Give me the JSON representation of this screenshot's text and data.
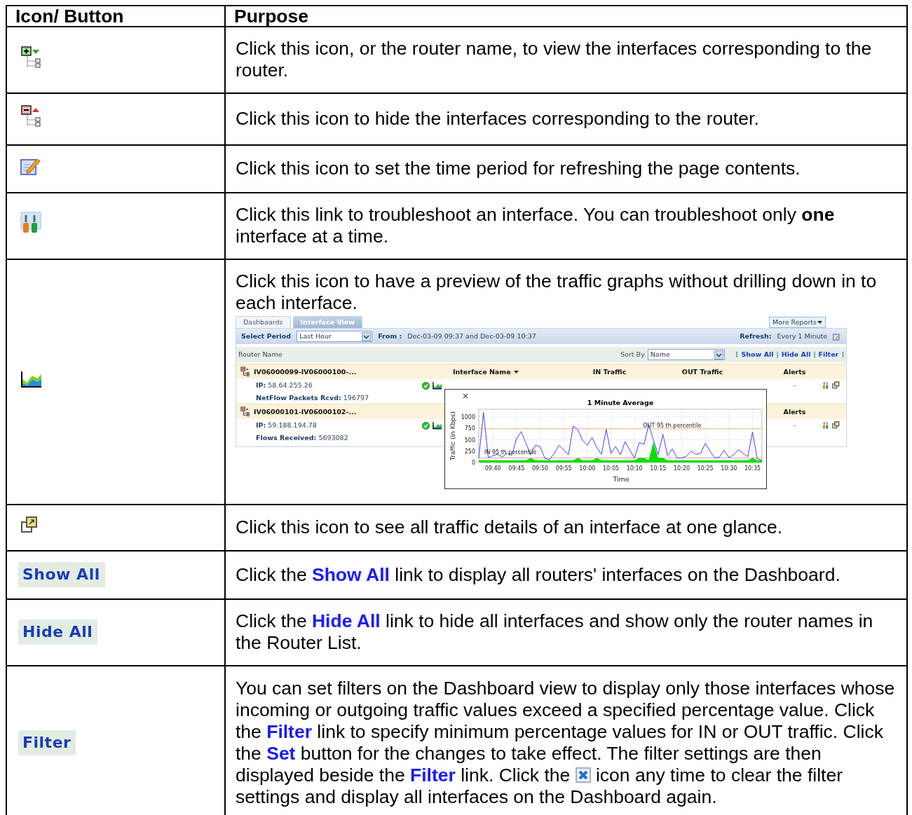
{
  "table": {
    "columns": [
      "Icon/ Button",
      "Purpose"
    ],
    "rows": [
      {
        "left": {
          "kind": "expand"
        },
        "purpose": [
          {
            "kind": "text",
            "text": "Click this icon, or the router name, to view the interfaces corresponding to the router."
          }
        ]
      },
      {
        "left": {
          "kind": "collapse"
        },
        "purpose": [
          {
            "kind": "text",
            "text": "Click this icon to hide the interfaces corresponding to the router."
          }
        ]
      },
      {
        "left": {
          "kind": "edit"
        },
        "purpose": [
          {
            "kind": "text",
            "text": "Click this icon to set the time period for refreshing the page contents."
          }
        ]
      },
      {
        "left": {
          "kind": "troubleshoot"
        },
        "purpose": [
          {
            "kind": "text",
            "text": "Click this link to troubleshoot an interface. You can troubleshoot only "
          },
          {
            "kind": "bold",
            "text": "one"
          },
          {
            "kind": "text",
            "text": " interface at a time."
          }
        ]
      },
      {
        "left": {
          "kind": "graph"
        },
        "purpose": [
          {
            "kind": "text",
            "text": "Click this icon to have a preview of the traffic graphs without drilling down in to each interface."
          }
        ],
        "preview": {
          "tabs": [
            {
              "label": "Dashboards",
              "selected": false
            },
            {
              "label": "Interface View",
              "selected": true
            }
          ],
          "more_reports": "More Reports",
          "period_label": "Select Period",
          "period_value": "Last Hour",
          "from_label": "From :",
          "from_value": "Dec-03-09 09:37 and Dec-03-09 10:37",
          "refresh_label": "Refresh:",
          "refresh_value": "Every 1 Minute",
          "router_name_label": "Router Name",
          "sort_label": "Sort By",
          "sort_value": "Name",
          "links": [
            {
              "kind": "punct",
              "text": "["
            },
            {
              "kind": "link",
              "text": "Show All"
            },
            {
              "kind": "punct",
              "text": "|"
            },
            {
              "kind": "link",
              "text": "Hide All"
            },
            {
              "kind": "punct",
              "text": "|"
            },
            {
              "kind": "link",
              "text": "Filter"
            },
            {
              "kind": "punct",
              "text": "]"
            }
          ],
          "routers": [
            {
              "name": "IV06000099-IV06000100-...",
              "headers": {
                "interface_name": "Interface Name",
                "in_traffic": "IN Traffic",
                "out_traffic": "OUT Traffic",
                "alerts": "Alerts"
              },
              "details": [
                {
                  "label": "IP:",
                  "value": "58.64.255.26"
                },
                {
                  "label": "NetFlow Packets Rcvd:",
                  "value": "196797"
                }
              ],
              "ok": true,
              "alerts": "-"
            },
            {
              "name": "IV06000101-IV06000102-...",
              "headers": {
                "alerts": "Alerts"
              },
              "details": [
                {
                  "label": "IP:",
                  "value": "59.188.194.78"
                },
                {
                  "label": "Flows Received:",
                  "value": "5693082"
                }
              ],
              "ok": true,
              "alerts": "-"
            }
          ],
          "popup": {
            "close": "×",
            "chart_data": {
              "type": "line",
              "title": "1 Minute Average",
              "xlabel": "Time",
              "ylabel": "Traffic (in Kbps)",
              "categories": [
                null,
                null,
                null,
                "09:40",
                null,
                null,
                null,
                null,
                "09:45",
                null,
                null,
                null,
                null,
                "09:50",
                null,
                null,
                null,
                null,
                "09:55",
                null,
                null,
                null,
                null,
                "10:00",
                null,
                null,
                null,
                null,
                "10:05",
                null,
                null,
                null,
                null,
                "10:10",
                null,
                null,
                null,
                null,
                "10:15",
                null,
                null,
                null,
                null,
                "10:20",
                null,
                null,
                null,
                null,
                "10:25",
                null,
                null,
                null,
                null,
                "10:30",
                null,
                null,
                null,
                null,
                "10:35",
                null,
                null
              ],
              "grid": true,
              "series": [
                {
                  "type": "area",
                  "color": "#00e000",
                  "values": [
                    50,
                    50,
                    50,
                    50,
                    50,
                    50,
                    50,
                    50,
                    50,
                    50,
                    50,
                    100,
                    50,
                    50,
                    50,
                    50,
                    50,
                    50,
                    50,
                    50,
                    50,
                    100,
                    50,
                    50,
                    50,
                    100,
                    50,
                    50,
                    50,
                    50,
                    50,
                    50,
                    50,
                    50,
                    100,
                    100,
                    50,
                    450,
                    100,
                    100,
                    50,
                    50,
                    50,
                    50,
                    50,
                    50,
                    50,
                    50,
                    50,
                    50,
                    50,
                    50,
                    50,
                    50,
                    50,
                    50,
                    50,
                    50,
                    100,
                    50,
                    50
                  ]
                },
                {
                  "type": "line",
                  "color": "#4040ff",
                  "values": [
                    100,
                    1100,
                    110,
                    150,
                    180,
                    120,
                    200,
                    160,
                    530,
                    680,
                    420,
                    170,
                    380,
                    350,
                    90,
                    60,
                    200,
                    380,
                    280,
                    170,
                    800,
                    720,
                    480,
                    380,
                    550,
                    330,
                    180,
                    730,
                    200,
                    350,
                    170,
                    460,
                    270,
                    100,
                    440,
                    400,
                    830,
                    500,
                    170,
                    620,
                    150,
                    300,
                    100,
                    100,
                    140,
                    250,
                    180,
                    200,
                    420,
                    250,
                    100,
                    120,
                    270,
                    110,
                    170,
                    280,
                    200,
                    130,
                    670,
                    80,
                    50
                  ]
                }
              ],
              "ylim": [
                0,
                1170
              ],
              "yticks": [
                0,
                250,
                500,
                750,
                1000
              ],
              "ref_lines": [
                {
                  "axis": "y",
                  "value": 740,
                  "label": "OUT 95 th percentile",
                  "color": "#f5b880"
                },
                {
                  "axis": "y",
                  "value": 100,
                  "label": "IN 95 th percentile",
                  "color": "#f0a0a0"
                }
              ]
            }
          }
        }
      },
      {
        "left": {
          "kind": "popout"
        },
        "purpose": [
          {
            "kind": "text",
            "text": "Click this icon to see all traffic details of an interface at one glance."
          }
        ]
      },
      {
        "left": {
          "kind": "link",
          "label": "Show All"
        },
        "purpose": [
          {
            "kind": "text",
            "text": "Click the "
          },
          {
            "kind": "link",
            "text": "Show All"
          },
          {
            "kind": "text",
            "text": " link to display all routers' interfaces on the Dashboard."
          }
        ]
      },
      {
        "left": {
          "kind": "link",
          "label": "Hide All"
        },
        "purpose": [
          {
            "kind": "text",
            "text": "Click the "
          },
          {
            "kind": "link",
            "text": "Hide All"
          },
          {
            "kind": "text",
            "text": " link to hide all interfaces and show only the router names in the Router List."
          }
        ]
      },
      {
        "left": {
          "kind": "link",
          "label": "Filter"
        },
        "purpose": [
          {
            "kind": "text",
            "text": "You can set filters on the Dashboard view to display only those interfaces whose incoming or outgoing traffic values exceed a specified percentage value. Click the "
          },
          {
            "kind": "link",
            "text": "Filter"
          },
          {
            "kind": "text",
            "text": " link to specify minimum percentage values for IN or OUT traffic. Click the "
          },
          {
            "kind": "link",
            "text": "Set"
          },
          {
            "kind": "text",
            "text": " button for the changes to take effect. The filter settings are then displayed beside the "
          },
          {
            "kind": "link",
            "text": "Filter"
          },
          {
            "kind": "text",
            "text": " link. Click the "
          },
          {
            "kind": "icon"
          },
          {
            "kind": "text",
            "text": " icon any time to clear the filter settings and display all interfaces on the Dashboard again."
          }
        ]
      }
    ]
  }
}
